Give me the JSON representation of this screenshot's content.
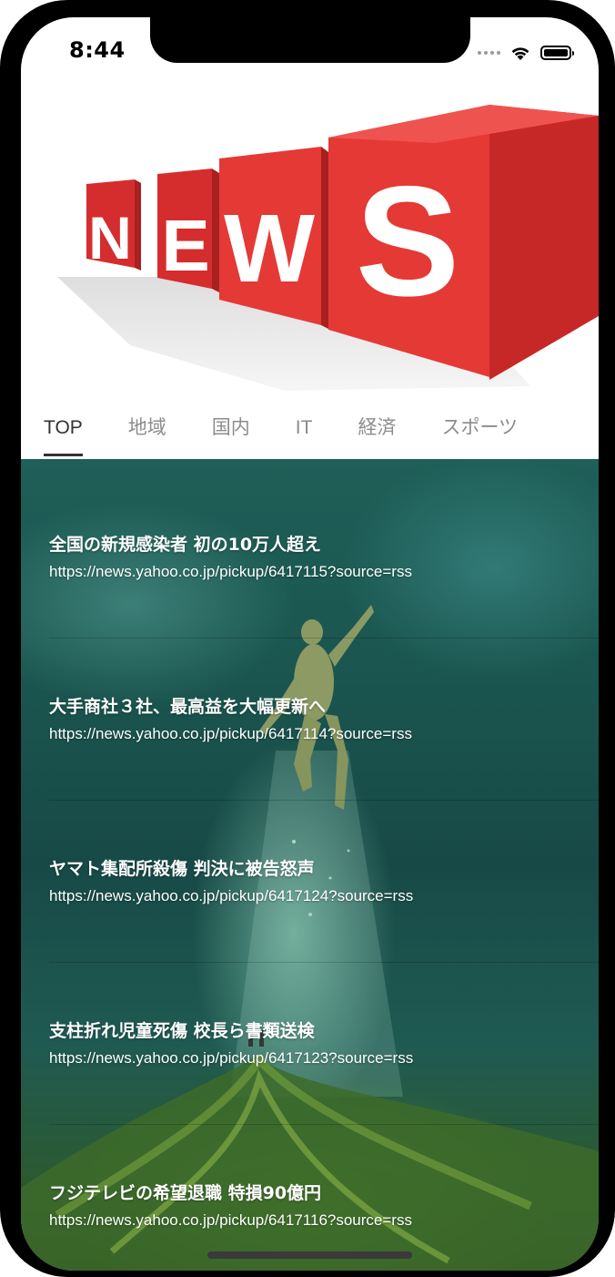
{
  "status_bar": {
    "time": "8:44"
  },
  "banner": {
    "letters": [
      "N",
      "E",
      "W",
      "S"
    ]
  },
  "tabs": [
    {
      "label": "TOP",
      "active": true
    },
    {
      "label": "地域",
      "active": false
    },
    {
      "label": "国内",
      "active": false
    },
    {
      "label": "IT",
      "active": false
    },
    {
      "label": "経済",
      "active": false
    },
    {
      "label": "スポーツ",
      "active": false
    }
  ],
  "news": [
    {
      "title": "全国の新規感染者 初の10万人超え",
      "url": "https://news.yahoo.co.jp/pickup/6417115?source=rss"
    },
    {
      "title": "大手商社３社、最高益を大幅更新へ",
      "url": "https://news.yahoo.co.jp/pickup/6417114?source=rss"
    },
    {
      "title": "ヤマト集配所殺傷 判決に被告怒声",
      "url": "https://news.yahoo.co.jp/pickup/6417124?source=rss"
    },
    {
      "title": "支柱折れ児童死傷 校長ら書類送検",
      "url": "https://news.yahoo.co.jp/pickup/6417123?source=rss"
    },
    {
      "title": "フジテレビの希望退職 特損90億円",
      "url": "https://news.yahoo.co.jp/pickup/6417116?source=rss"
    }
  ],
  "colors": {
    "accent_red": "#e53935",
    "tab_active": "#333333",
    "tab_inactive": "#8c8c8c"
  }
}
